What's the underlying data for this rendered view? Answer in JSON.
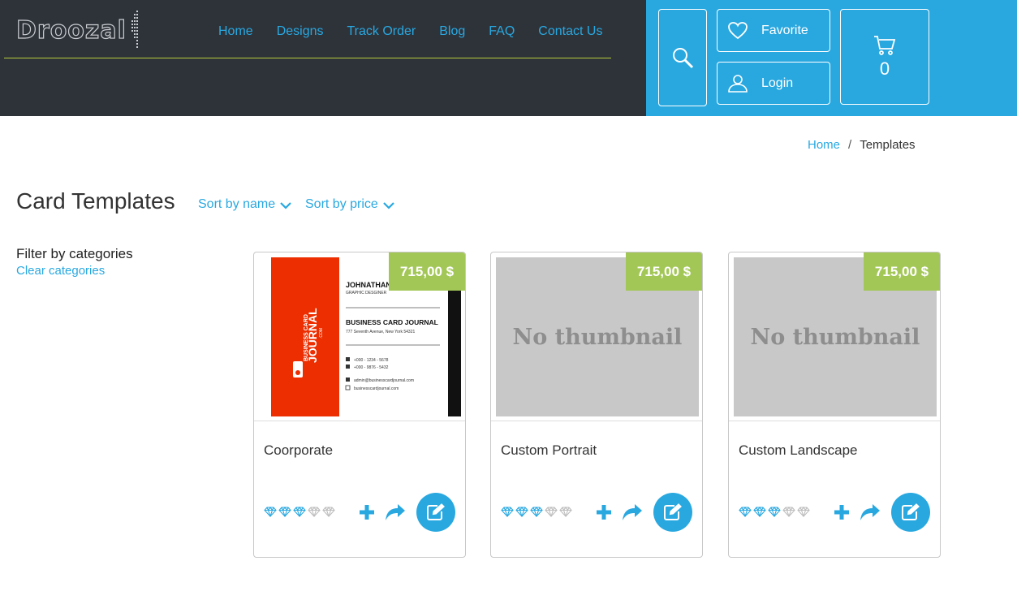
{
  "brand": {
    "name": "Droozal"
  },
  "nav": {
    "items": [
      "Home",
      "Designs",
      "Track Order",
      "Blog",
      "FAQ",
      "Contact Us"
    ]
  },
  "header": {
    "favorite_label": "Favorite",
    "login_label": "Login",
    "cart_count": "0"
  },
  "breadcrumb": {
    "home": "Home",
    "separator": "/",
    "current": "Templates"
  },
  "page": {
    "title": "Card Templates",
    "sort_name": "Sort by name",
    "sort_price": "Sort by price",
    "filter_title": "Filter by categories",
    "filter_clear": "Clear categories"
  },
  "cards": [
    {
      "title": "Coorporate",
      "price": "715,00 $",
      "thumbnail": "business-card",
      "rating": 3,
      "rating_max": 5
    },
    {
      "title": "Custom Portrait",
      "price": "715,00 $",
      "thumbnail": "none",
      "no_thumbnail_text": "No thumbnail",
      "rating": 3,
      "rating_max": 5
    },
    {
      "title": "Custom Landscape",
      "price": "715,00 $",
      "thumbnail": "none",
      "no_thumbnail_text": "No thumbnail",
      "rating": 3,
      "rating_max": 5
    }
  ],
  "business_card": {
    "brand_line1": "BUSINESS CARD",
    "brand_line2": "JOURNAL",
    "brand_line3": ".COM",
    "name": "JOHNATHAN",
    "role": "GRAPHIC DESGINER",
    "company": "BUSINESS CARD JOURNAL",
    "address": "777 Seventh Avenue, New York 54321",
    "phone": "+000 - 1234 - 5678",
    "fax": "+000 - 9876 - 5432",
    "email": "admin@businesscardjournal.com",
    "web": "businesscardjournal.com"
  },
  "colors": {
    "dark": "#2e333a",
    "accent": "#29a8e0",
    "price": "#a3c757",
    "nav_line": "#b7cc3a",
    "card_red": "#ec2e00"
  },
  "icons": {
    "search": "search-icon",
    "favorite": "heart-icon",
    "login": "user-icon",
    "cart": "cart-icon",
    "sort": "chevron-down-icon",
    "add": "plus-icon",
    "share": "share-icon",
    "edit": "edit-icon",
    "rating": "diamond-icon"
  }
}
